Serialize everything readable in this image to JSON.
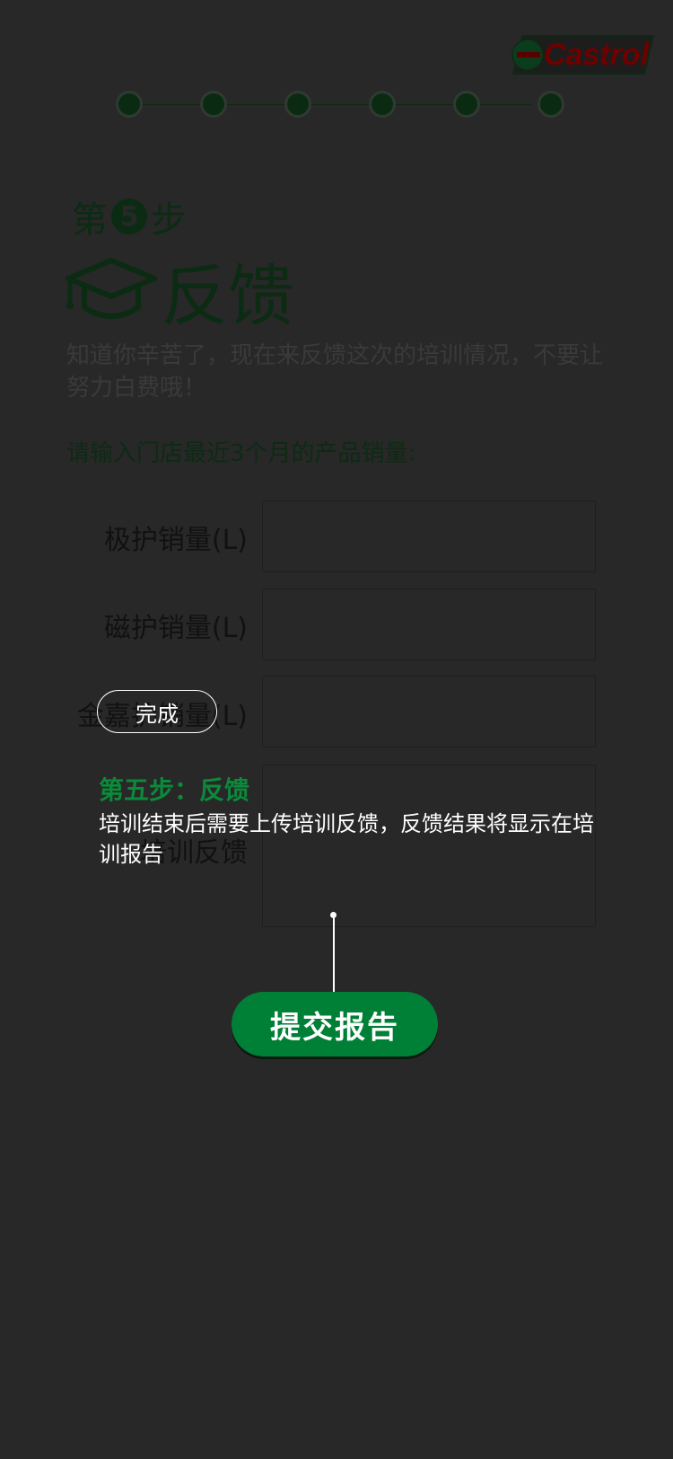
{
  "brand": {
    "logo_text": "Castrol"
  },
  "progress": {
    "total_steps": 6
  },
  "header": {
    "step_prefix": "第",
    "step_number": "5",
    "step_suffix": "步",
    "title": "反馈",
    "intro": "知道你辛苦了，现在来反馈这次的培训情况，不要让努力白费哦！"
  },
  "form": {
    "prompt": "请输入门店最近3个月的产品销量:",
    "fields": [
      {
        "label": "极护销量(L)",
        "value": ""
      },
      {
        "label": "磁护销量(L)",
        "value": ""
      },
      {
        "label": "金嘉护销量(L)",
        "value": ""
      },
      {
        "label": "培训反馈",
        "value": ""
      }
    ],
    "submit_label": "提交报告"
  },
  "tooltip": {
    "done_label": "完成",
    "title": "第五步：反馈",
    "body": "培训结束后需要上传培训反馈，反馈结果将显示在培训报告"
  },
  "colors": {
    "accent": "#007f36",
    "logo_red": "#7a0000",
    "logo_green": "#0a8a3a"
  }
}
